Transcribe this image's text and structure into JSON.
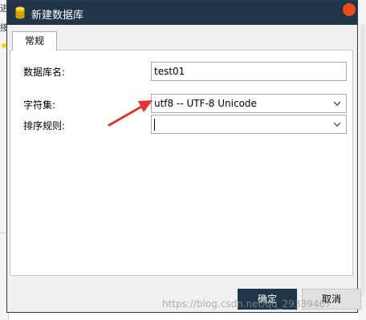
{
  "background": {
    "left_text_1": "进",
    "left_text_2": "接"
  },
  "dialog": {
    "title": "新建数据库",
    "icons": {
      "app": "database-icon",
      "close": "close-icon",
      "dropdown": "chevron-down-icon"
    }
  },
  "tabs": [
    {
      "label": "常规",
      "selected": true
    }
  ],
  "form": {
    "db_name_label": "数据库名:",
    "db_name_value": "test01",
    "charset_label": "字符集:",
    "charset_value": "utf8 -- UTF-8 Unicode",
    "collation_label": "排序规则:",
    "collation_value": ""
  },
  "buttons": {
    "ok": "确定",
    "cancel": "取消"
  },
  "watermark": "https://blog.csdn.net/qq_29339467",
  "colors": {
    "titlebar": "#1f3548",
    "primary_button": "#1f3548",
    "close": "#f04a1a",
    "annotation_arrow": "#e8312a"
  }
}
